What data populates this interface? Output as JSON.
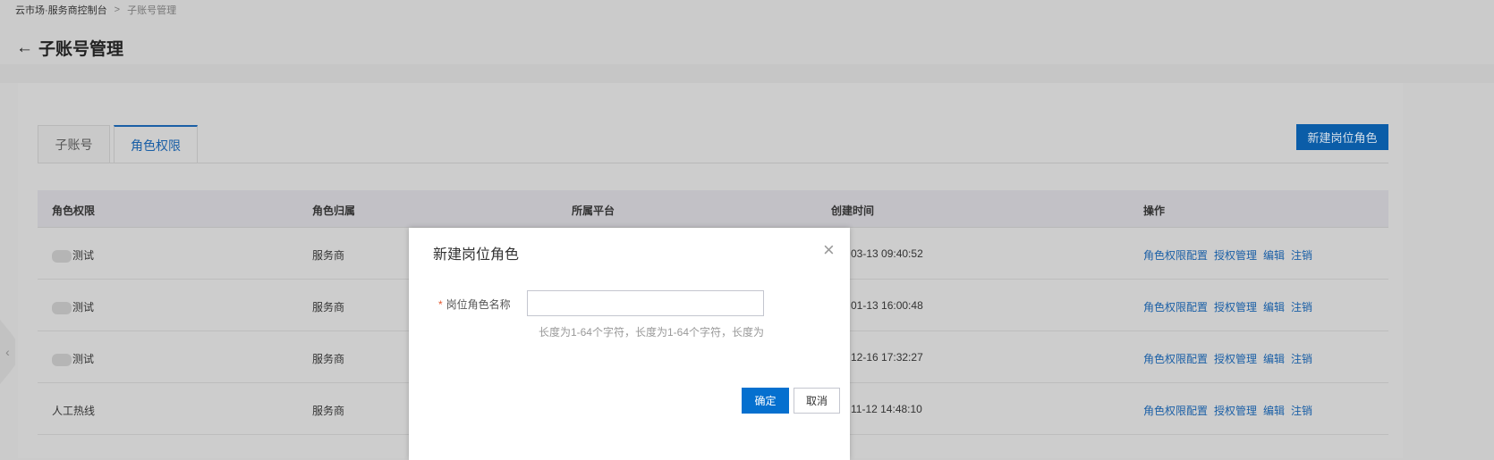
{
  "breadcrumb": {
    "root": "云市场·服务商控制台",
    "separator": ">",
    "current": "子账号管理"
  },
  "header": {
    "title": "子账号管理",
    "back_icon": "arrow-left-icon"
  },
  "tabs": [
    {
      "label": "子账号"
    },
    {
      "label": "角色权限"
    }
  ],
  "new_role_button": "新建岗位角色",
  "table": {
    "columns": [
      "角色权限",
      "角色归属",
      "所属平台",
      "创建时间",
      "操作"
    ],
    "rows": [
      {
        "name": "测试",
        "owner": "服务商",
        "created": "03-13 09:40:52"
      },
      {
        "name": "测试",
        "owner": "服务商",
        "created": "01-13 16:00:48"
      },
      {
        "name": "测试",
        "owner": "服务商",
        "created": "12-16 17:32:27"
      },
      {
        "name": "人工热线",
        "owner": "服务商",
        "created": "11-12 14:48:10"
      }
    ],
    "actions": [
      "角色权限配置",
      "授权管理",
      "编辑",
      "注销"
    ]
  },
  "modal": {
    "title": "新建岗位角色",
    "field_label": "岗位角色名称",
    "required_mark": "*",
    "field_value": "",
    "hint": "长度为1-64个字符，长度为1-64个字符，长度为",
    "ok": "确定",
    "cancel": "取消"
  },
  "colors": {
    "primary": "#0570cf",
    "link": "#1a5fa6"
  }
}
